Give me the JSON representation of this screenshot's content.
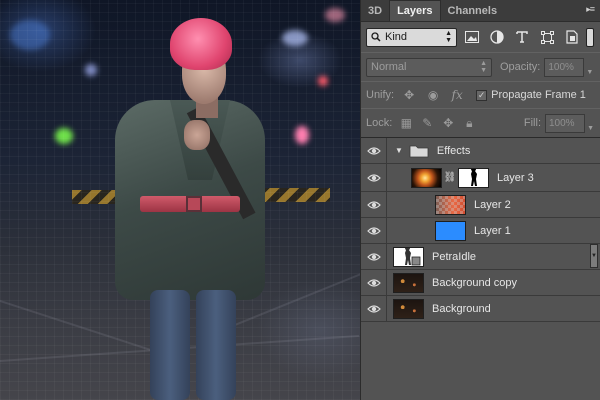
{
  "tabs": [
    {
      "label": "3D",
      "active": false
    },
    {
      "label": "Layers",
      "active": true
    },
    {
      "label": "Channels",
      "active": false
    }
  ],
  "filter": {
    "kind_label": "Kind",
    "icons": [
      "image-filter-icon",
      "adjustment-filter-icon",
      "type-filter-icon",
      "shape-filter-icon",
      "smart-object-filter-icon"
    ]
  },
  "blend": {
    "mode": "Normal",
    "opacity_label": "Opacity:",
    "opacity_value": "100%"
  },
  "unify": {
    "label": "Unify:",
    "propagate_label": "Propagate Frame 1",
    "propagate_checked": true
  },
  "lock": {
    "label": "Lock:",
    "fill_label": "Fill:",
    "fill_value": "100%"
  },
  "layers": [
    {
      "name": "Effects",
      "type": "group",
      "expanded": true
    },
    {
      "name": "Layer 3",
      "type": "masked"
    },
    {
      "name": "Layer 2",
      "type": "gradient"
    },
    {
      "name": "Layer 1",
      "type": "fill"
    },
    {
      "name": "PetraIdle",
      "type": "smart-object"
    },
    {
      "name": "Background copy",
      "type": "image"
    },
    {
      "name": "Background",
      "type": "image"
    }
  ],
  "colors": {
    "panel_bg": "#535353",
    "layer1_fill": "#2b8cff",
    "hair": "#e0456f",
    "belt": "#c24e5e"
  }
}
